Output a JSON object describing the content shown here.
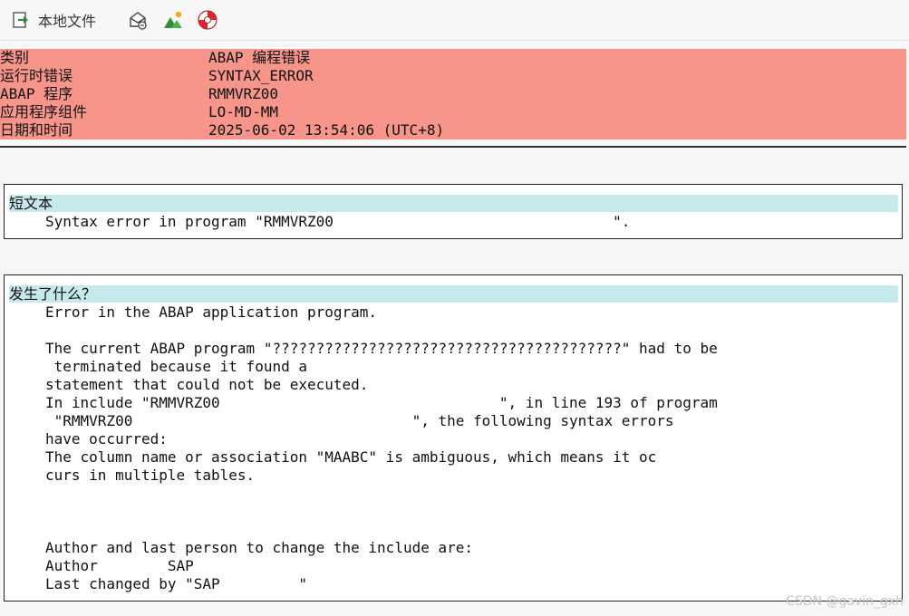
{
  "toolbar": {
    "local_file_label": "本地文件",
    "icons": [
      "export-icon",
      "mail-icon",
      "image-icon",
      "help-lifebuoy-icon"
    ]
  },
  "header": {
    "rows": [
      {
        "key": "类别",
        "value": "ABAP 编程错误"
      },
      {
        "key": "运行时错误",
        "value": "SYNTAX_ERROR"
      },
      {
        "key": "ABAP 程序",
        "value": "RMMVRZ00"
      },
      {
        "key": "应用程序组件",
        "value": "LO-MD-MM"
      },
      {
        "key": "日期和时间",
        "value": "2025-06-02 13:54:06 (UTC+8)"
      }
    ]
  },
  "short_text": {
    "title": "短文本",
    "lines": [
      "Syntax error in program \"RMMVRZ00                                \"."
    ]
  },
  "what_happened": {
    "title": "发生了什么？",
    "lines": [
      "Error in the ABAP application program.",
      "",
      "The current ABAP program \"????????????????????????????????????????\" had to be",
      " terminated because it found a",
      "statement that could not be executed.",
      "In include \"RMMVRZ00                                \", in line 193 of program",
      " \"RMMVRZ00                                \", the following syntax errors",
      "have occurred:",
      "The column name or association \"MAABC\" is ambiguous, which means it oc",
      "curs in multiple tables.",
      "",
      "",
      "",
      "Author and last person to change the include are:",
      "Author        SAP",
      "Last changed by \"SAP         \""
    ]
  },
  "watermark": "CSDN @gavin_gxh",
  "colors": {
    "header_bg": "#f7958b",
    "title_bg": "#c6e9ec"
  }
}
